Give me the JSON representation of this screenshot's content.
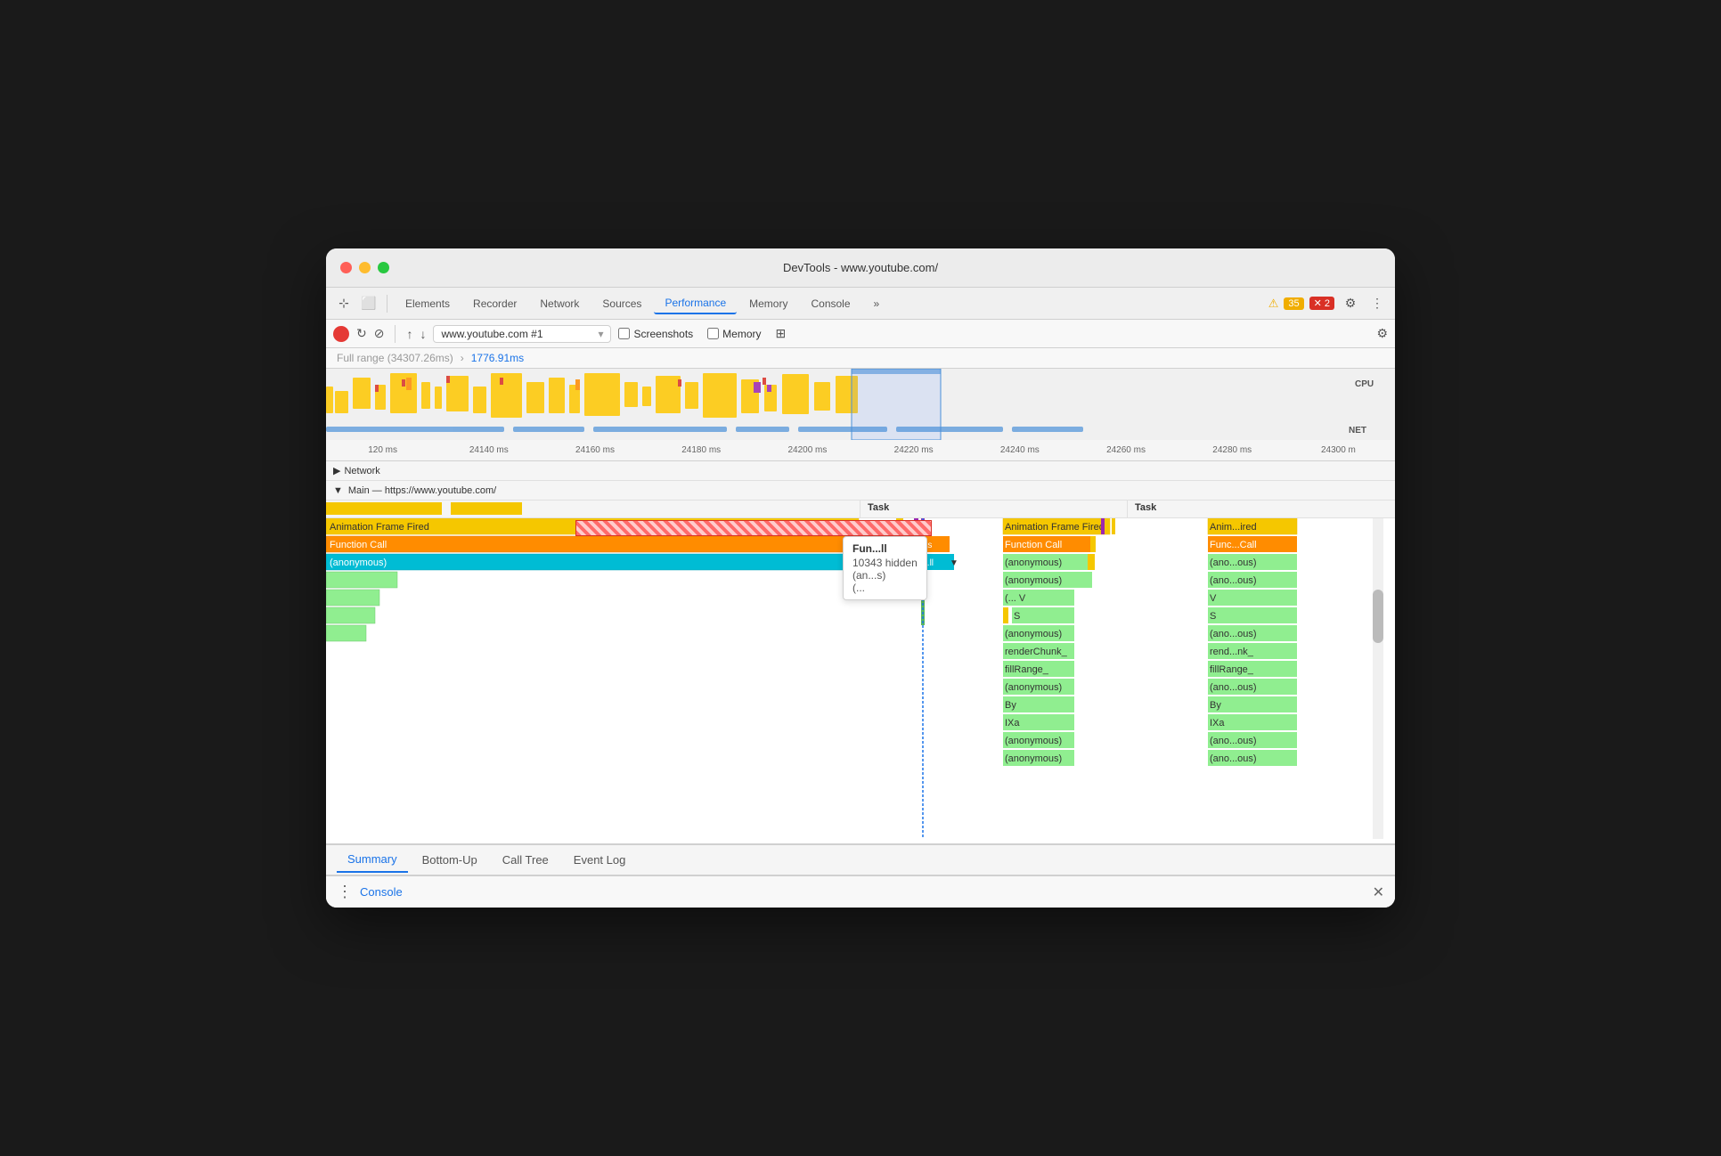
{
  "window": {
    "title": "DevTools - www.youtube.com/"
  },
  "toolbar": {
    "tabs": [
      {
        "label": "Elements",
        "active": false
      },
      {
        "label": "Recorder",
        "active": false
      },
      {
        "label": "Network",
        "active": false
      },
      {
        "label": "Sources",
        "active": false
      },
      {
        "label": "Performance",
        "active": true
      },
      {
        "label": "Memory",
        "active": false
      },
      {
        "label": "Console",
        "active": false
      },
      {
        "label": "»",
        "active": false
      }
    ],
    "warn_count": "35",
    "error_count": "2"
  },
  "toolbar2": {
    "url": "www.youtube.com #1",
    "screenshots_label": "Screenshots",
    "memory_label": "Memory"
  },
  "range": {
    "full_range": "Full range (34307.26ms)",
    "selected": "1776.91ms"
  },
  "time_ticks": [
    "120 ms",
    "24140 ms",
    "24160 ms",
    "24180 ms",
    "24200 ms",
    "24220 ms",
    "24240 ms",
    "24260 ms",
    "24280 ms",
    "24300 m"
  ],
  "flame": {
    "main_label": "Main — https://www.youtube.com/",
    "network_label": "Network",
    "task_col_header": "Task",
    "rows": [
      {
        "label": "Animation Frame Fired",
        "color": "orange"
      },
      {
        "label": "Function Call",
        "color": "orange"
      },
      {
        "label": "(anonymous)",
        "color": "cyan"
      }
    ]
  },
  "tooltip": {
    "title": "Fun...ll",
    "hidden_count": "10343 hidden",
    "item1": "(an...s)",
    "item2": "(...",
    "marker": "▼"
  },
  "bottom_tabs": [
    {
      "label": "Summary",
      "active": true
    },
    {
      "label": "Bottom-Up",
      "active": false
    },
    {
      "label": "Call Tree",
      "active": false
    },
    {
      "label": "Event Log",
      "active": false
    }
  ],
  "console_bar": {
    "dots": "⋮",
    "label": "Console",
    "close": "✕"
  },
  "right_column": {
    "rows": [
      {
        "label": "Animation Frame Fired"
      },
      {
        "label": "Function Call"
      },
      {
        "label": "(anonymous)"
      },
      {
        "label": "(anonymous)"
      },
      {
        "label": "(... V"
      },
      {
        "label": "S"
      },
      {
        "label": "(anonymous)"
      },
      {
        "label": "renderChunk_"
      },
      {
        "label": "fillRange_"
      },
      {
        "label": "(anonymous)"
      },
      {
        "label": "By"
      },
      {
        "label": "IXa"
      },
      {
        "label": "(anonymous)"
      },
      {
        "label": "(anonymous)"
      }
    ]
  },
  "far_right_column": {
    "rows": [
      {
        "label": "Anim...ired"
      },
      {
        "label": "Func...Call"
      },
      {
        "label": "(ano...ous)"
      },
      {
        "label": "(ano...ous)"
      },
      {
        "label": "V"
      },
      {
        "label": "S"
      },
      {
        "label": "(ano...ous)"
      },
      {
        "label": "rend...nk_"
      },
      {
        "label": "fillRange_"
      },
      {
        "label": "(ano...ous)"
      },
      {
        "label": "By"
      },
      {
        "label": "IXa"
      },
      {
        "label": "(ano...ous)"
      },
      {
        "label": "(ano...ous)"
      }
    ]
  }
}
